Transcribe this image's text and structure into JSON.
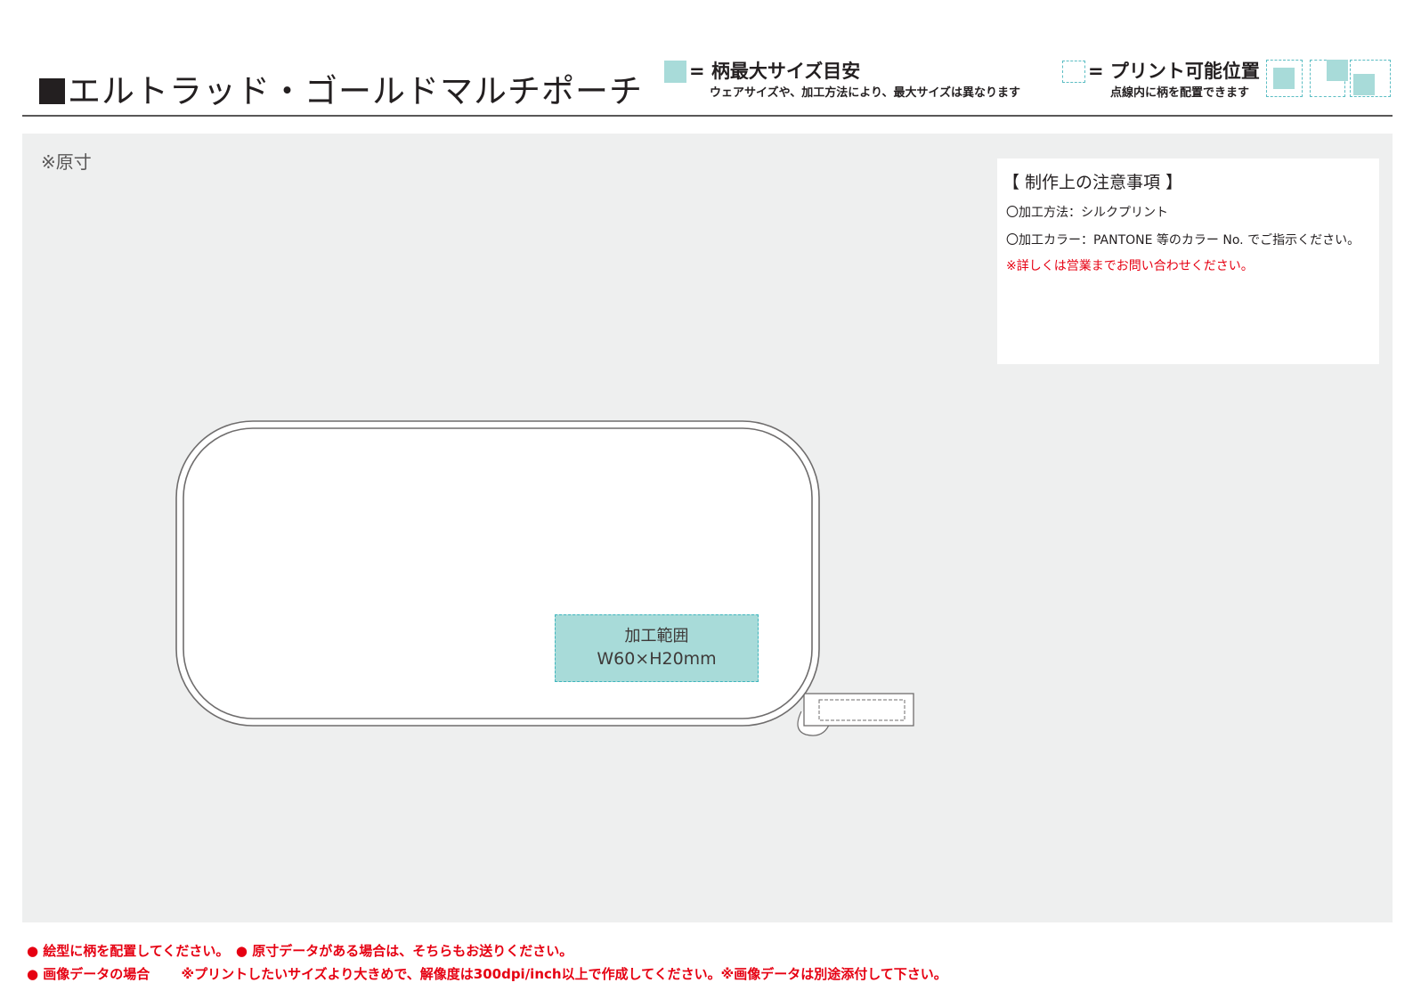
{
  "header": {
    "title": "エルトラッド・ゴールドマルチポーチ",
    "legend_max_size": {
      "label": "= 柄最大サイズ目安",
      "note": "ウェアサイズや、加工方法により、最大サイズは異なります",
      "swatch_color": "#a8dbd9"
    },
    "legend_print_position": {
      "label": "= プリント可能位置",
      "note": "点線内に柄を配置できます",
      "border_color": "#5bbdc3"
    }
  },
  "canvas": {
    "scale_note": "※原寸",
    "background_color": "#eeefef"
  },
  "notes": {
    "title": "【 制作上の注意事項 】",
    "lines": [
      "〇加工方法：シルクプリント",
      "〇加工カラー：PANTONE 等のカラー No. でご指示ください。"
    ],
    "warning": "※詳しくは営業までお問い合わせください。",
    "warning_color": "#e60012"
  },
  "print_area": {
    "label": "加工範囲",
    "size": "W60×H20mm",
    "fill_color": "#a8dbd9"
  },
  "footer": {
    "line1": "● 絵型に柄を配置してください。　● 原寸データがある場合は、そちらもお送りください。",
    "line2": "● 画像データの場合　　 ※プリントしたいサイズより大きめで、解像度は300dpi/inch以上で作成してください。※画像データは別途添付して下さい。",
    "color": "#e60012"
  }
}
